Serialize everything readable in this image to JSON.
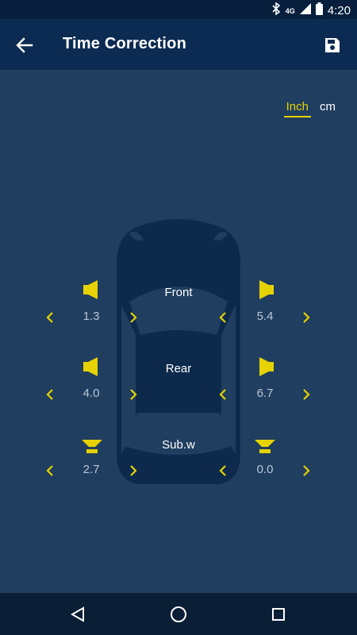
{
  "status_bar": {
    "time": "4:20",
    "network": "4G",
    "icons": [
      "bluetooth-icon",
      "signal-icon",
      "battery-icon"
    ]
  },
  "header": {
    "title": "Time Correction",
    "back_icon": "arrow-left-icon",
    "save_icon": "save-icon"
  },
  "units": {
    "options": [
      "Inch",
      "cm"
    ],
    "selected": "Inch"
  },
  "zones": {
    "front": {
      "label": "Front",
      "left": "1.3",
      "right": "5.4"
    },
    "rear": {
      "label": "Rear",
      "left": "4.0",
      "right": "6.7"
    },
    "sub": {
      "label": "Sub.w",
      "left": "2.7",
      "right": "0.0"
    }
  },
  "colors": {
    "accent": "#e6d200",
    "background": "#203e5f",
    "appbar": "#0c2b52",
    "car": "#0d2a4d"
  },
  "nav": {
    "buttons": [
      "back-icon",
      "home-icon",
      "recents-icon"
    ]
  }
}
